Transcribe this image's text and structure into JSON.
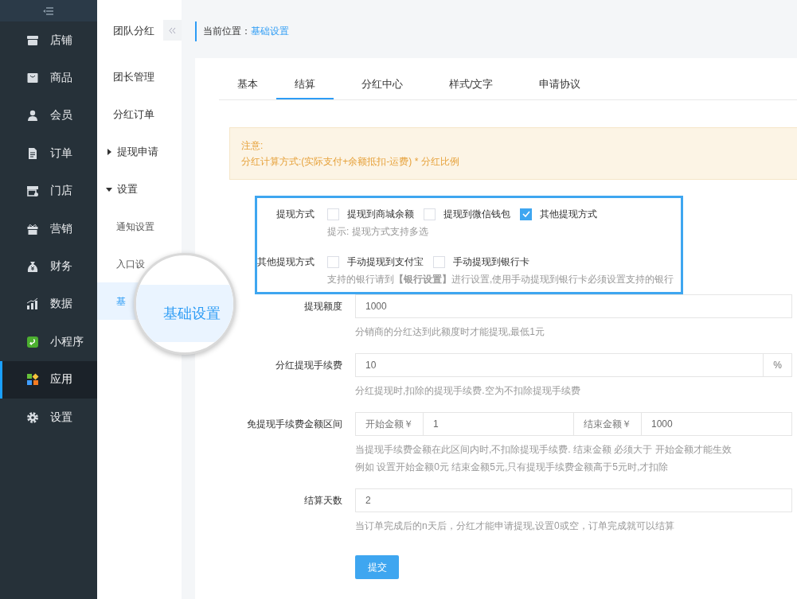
{
  "sidebar": {
    "items": [
      {
        "label": "店铺",
        "selected": false
      },
      {
        "label": "商品",
        "selected": false
      },
      {
        "label": "会员",
        "selected": false
      },
      {
        "label": "订单",
        "selected": false
      },
      {
        "label": "门店",
        "selected": false
      },
      {
        "label": "营销",
        "selected": false
      },
      {
        "label": "财务",
        "selected": false
      },
      {
        "label": "数据",
        "selected": false
      },
      {
        "label": "小程序",
        "selected": false
      },
      {
        "label": "应用",
        "selected": true
      },
      {
        "label": "设置",
        "selected": false
      }
    ]
  },
  "subnav": {
    "title": "团队分红",
    "items": [
      {
        "label": "团长管理",
        "selected": false
      },
      {
        "label": "分红订单",
        "selected": false
      },
      {
        "label": "提现申请",
        "expanded": false
      },
      {
        "label": "设置",
        "expanded": true,
        "children": [
          {
            "label": "通知设置",
            "selected": false
          },
          {
            "label": "入口设",
            "selected": false
          },
          {
            "label": "基",
            "selected": true
          }
        ]
      }
    ]
  },
  "magnifier": {
    "label": "基础设置"
  },
  "breadcrumb": {
    "label": "当前位置：",
    "current": "基础设置"
  },
  "tabs": [
    {
      "label": "基本",
      "selected": false
    },
    {
      "label": "结算",
      "selected": true
    },
    {
      "label": "分红中心",
      "selected": false
    },
    {
      "label": "样式/文字",
      "selected": false
    },
    {
      "label": "申请协议",
      "selected": false
    }
  ],
  "notice": {
    "title": "注意:",
    "text": "分红计算方式:(实际支付+余额抵扣-运费) * 分红比例"
  },
  "form": [
    {
      "kind": "checkboxes",
      "label": "提现方式",
      "options": [
        {
          "label": "提现到商城余额",
          "checked": false
        },
        {
          "label": "提现到微信钱包",
          "checked": false
        },
        {
          "label": "其他提现方式",
          "checked": true
        }
      ],
      "hints": [
        "提示: 提现方式支持多选"
      ]
    },
    {
      "kind": "checkboxes",
      "label": "其他提现方式",
      "options": [
        {
          "label": "手动提现到支付宝",
          "checked": false
        },
        {
          "label": "手动提现到银行卡",
          "checked": false
        }
      ],
      "hints": [
        "支持的银行请到**【银行设置】**进行设置,使用手动提现到银行卡必须设置支持的银行"
      ]
    },
    {
      "kind": "input",
      "label": "提现额度",
      "value": "1000",
      "hints": [
        "分销商的分红达到此额度时才能提现,最低1元"
      ]
    },
    {
      "kind": "suffix",
      "label": "分红提现手续费",
      "value": "10",
      "suffix": "%",
      "hints": [
        "分红提现时,扣除的提现手续费.空为不扣除提现手续费"
      ]
    },
    {
      "kind": "range",
      "label": "免提现手续费金额区间",
      "start_label": "开始金额￥",
      "start": "1",
      "end_label": "结束金额￥",
      "end": "1000",
      "hints": [
        "当提现手续费金额在此区间内时,不扣除提现手续费. 结束金额 必须大于 开始金额才能生效",
        "例如 设置开始金额0元 结束金额5元,只有提现手续费金额高于5元时,才扣除"
      ]
    },
    {
      "kind": "input",
      "label": "结算天数",
      "value": "2",
      "hints": [
        "当订单完成后的n天后，分红才能申请提现,设置0或空，订单完成就可以结算"
      ]
    }
  ],
  "submit": "提交"
}
